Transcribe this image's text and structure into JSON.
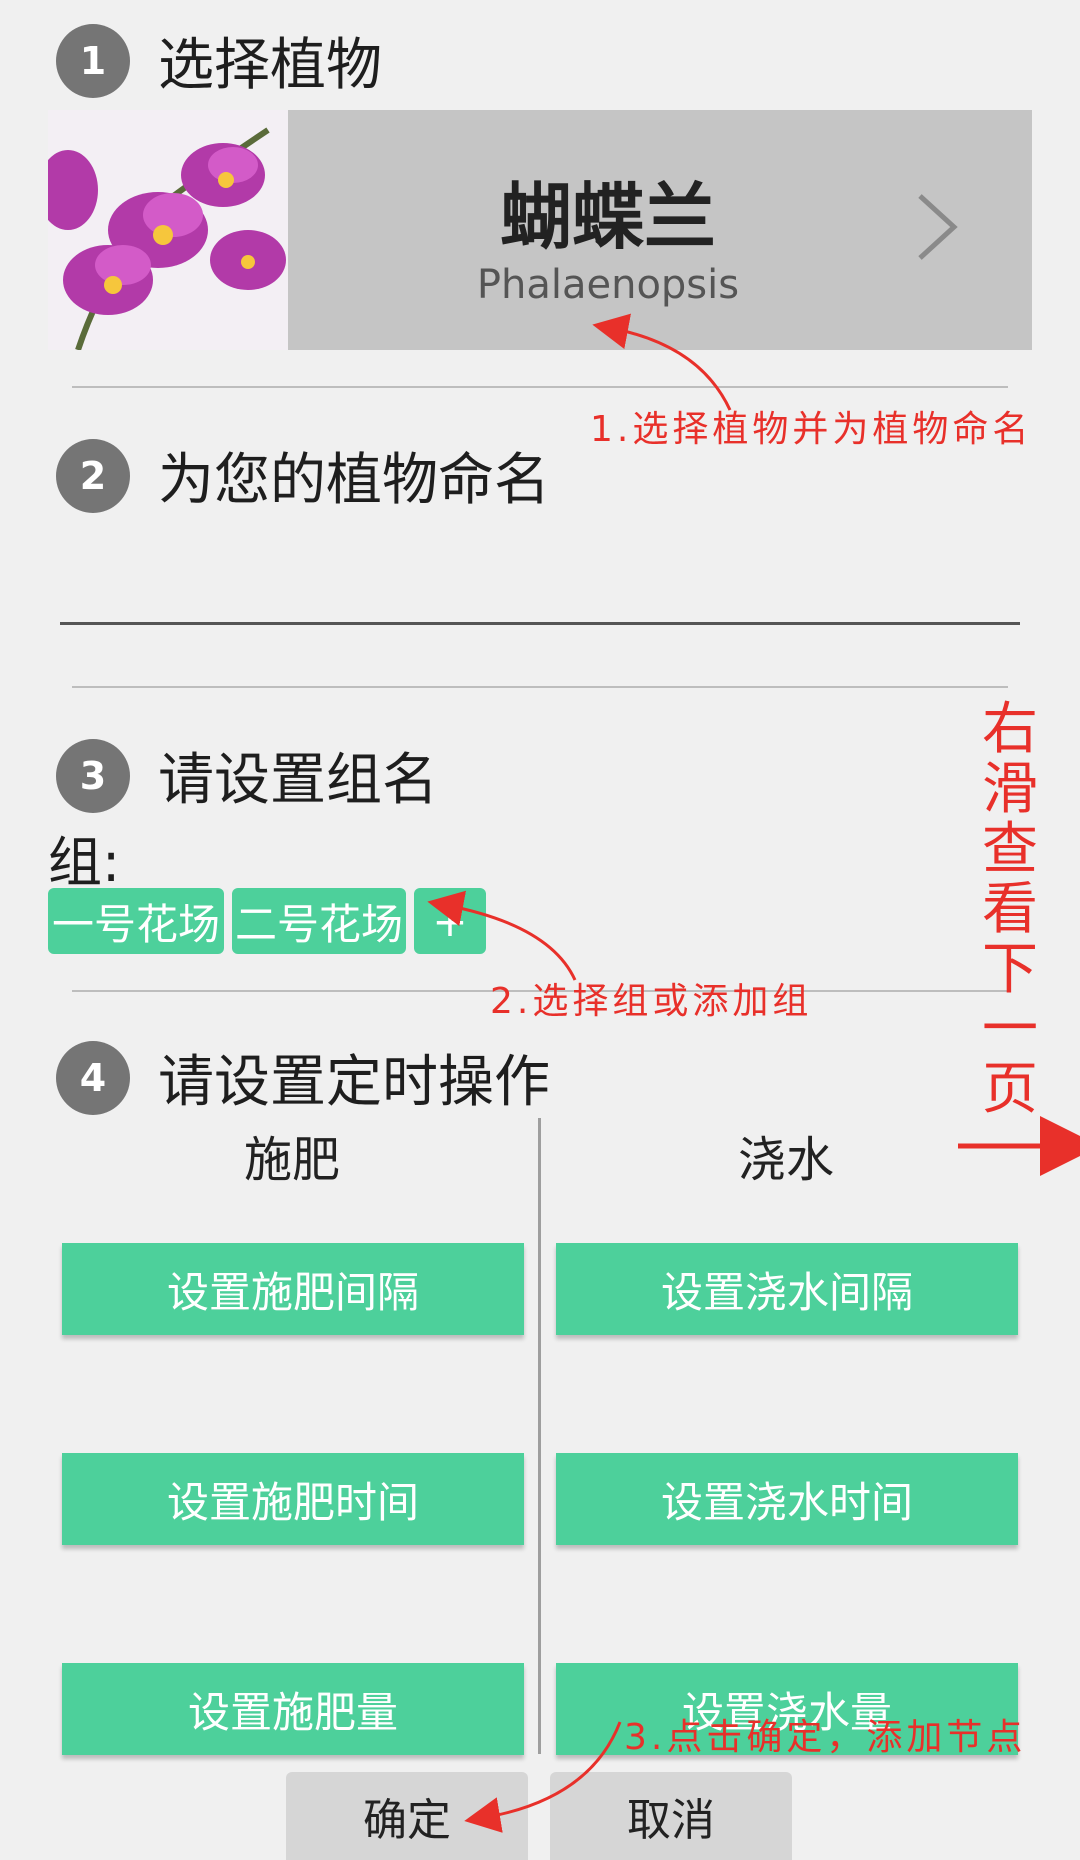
{
  "steps": [
    {
      "num": "1",
      "title": "选择植物"
    },
    {
      "num": "2",
      "title": "为您的植物命名"
    },
    {
      "num": "3",
      "title": "请设置组名"
    },
    {
      "num": "4",
      "title": "请设置定时操作"
    }
  ],
  "plant": {
    "name": "蝴蝶兰",
    "latin": "Phalaenopsis"
  },
  "name_field": {
    "value": ""
  },
  "groups": {
    "label": "组:",
    "chips": [
      "一号花场",
      "二号花场",
      "+"
    ]
  },
  "schedule": {
    "fertilize": {
      "header": "施肥",
      "buttons": [
        "设置施肥间隔",
        "设置施肥时间",
        "设置施肥量"
      ]
    },
    "water": {
      "header": "浇水",
      "buttons": [
        "设置浇水间隔",
        "设置浇水时间",
        "设置浇水量"
      ]
    }
  },
  "footer": {
    "confirm": "确定",
    "cancel": "取消"
  },
  "annotations": {
    "a1": "1.选择植物并为植物命名",
    "a2": "2.选择组或添加组",
    "a3": "3.点击确定，添加节点",
    "swipe": "右滑查看下一页"
  },
  "colors": {
    "accent": "#4dd09b",
    "annotation": "#e8302a",
    "background": "#f0f0f0"
  }
}
